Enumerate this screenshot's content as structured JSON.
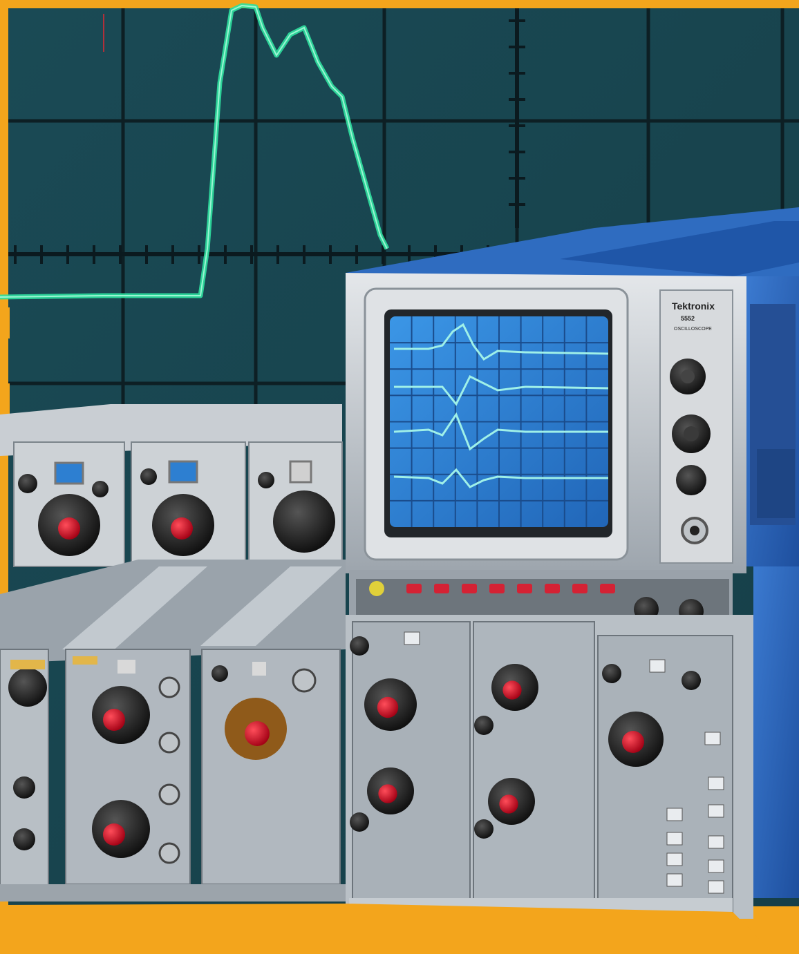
{
  "brand": {
    "name": "Tektronix",
    "model": "5552",
    "subtitle": "OSCILLOSCOPE"
  },
  "colors": {
    "border": "#f3a51c",
    "screen_bg": "#1d4f55",
    "trace": "#30d89a",
    "cabinet_blue": "#2a64b8",
    "crt_blue": "#2d7fd1",
    "crt_trace": "#8fe7e0",
    "knob_red": "#d8142a",
    "panel_silver": "#c8cdd2"
  },
  "icons": [
    "large-trace-waveform",
    "crt-waveforms",
    "knob",
    "bnc-connector",
    "indicator-light"
  ]
}
